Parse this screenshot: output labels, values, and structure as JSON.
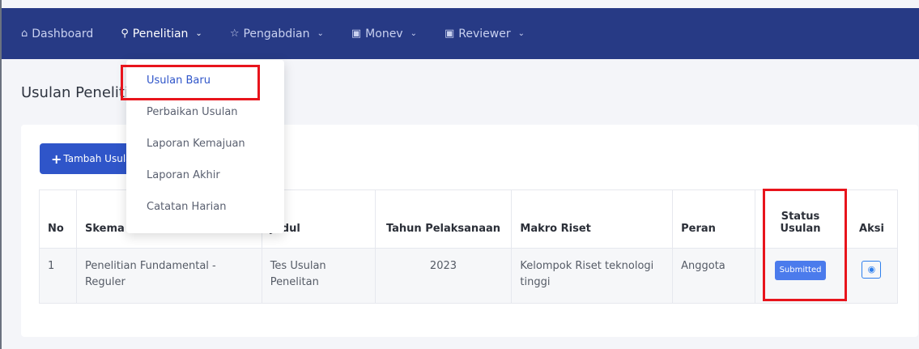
{
  "nav": {
    "items": [
      {
        "label": "Dashboard",
        "icon": "home-icon"
      },
      {
        "label": "Penelitian",
        "icon": "search-icon"
      },
      {
        "label": "Pengabdian",
        "icon": "star-icon"
      },
      {
        "label": "Monev",
        "icon": "doc-icon"
      },
      {
        "label": "Reviewer",
        "icon": "doc-icon"
      }
    ]
  },
  "dropdown": {
    "items": [
      "Usulan Baru",
      "Perbaikan Usulan",
      "Laporan Kemajuan",
      "Laporan Akhir",
      "Catatan Harian"
    ]
  },
  "page": {
    "title": "Usulan Penelitian"
  },
  "card": {
    "add_button": "Tambah Usulan"
  },
  "table": {
    "headers": [
      "No",
      "Skema",
      "Judul",
      "Tahun Pelaksanaan",
      "Makro Riset",
      "Peran",
      "Status Usulan",
      "Aksi"
    ],
    "rows": [
      {
        "no": "1",
        "skema": "Penelitian Fundamental - Reguler",
        "judul": "Tes Usulan Penelitan",
        "tahun": "2023",
        "makro": "Kelompok Riset teknologi tinggi",
        "peran": "Anggota",
        "status": "Submitted"
      }
    ]
  },
  "colors": {
    "nav_bg": "#273a85",
    "primary": "#2f55c9",
    "badge": "#4b7bec",
    "highlight": "#e8141c"
  }
}
